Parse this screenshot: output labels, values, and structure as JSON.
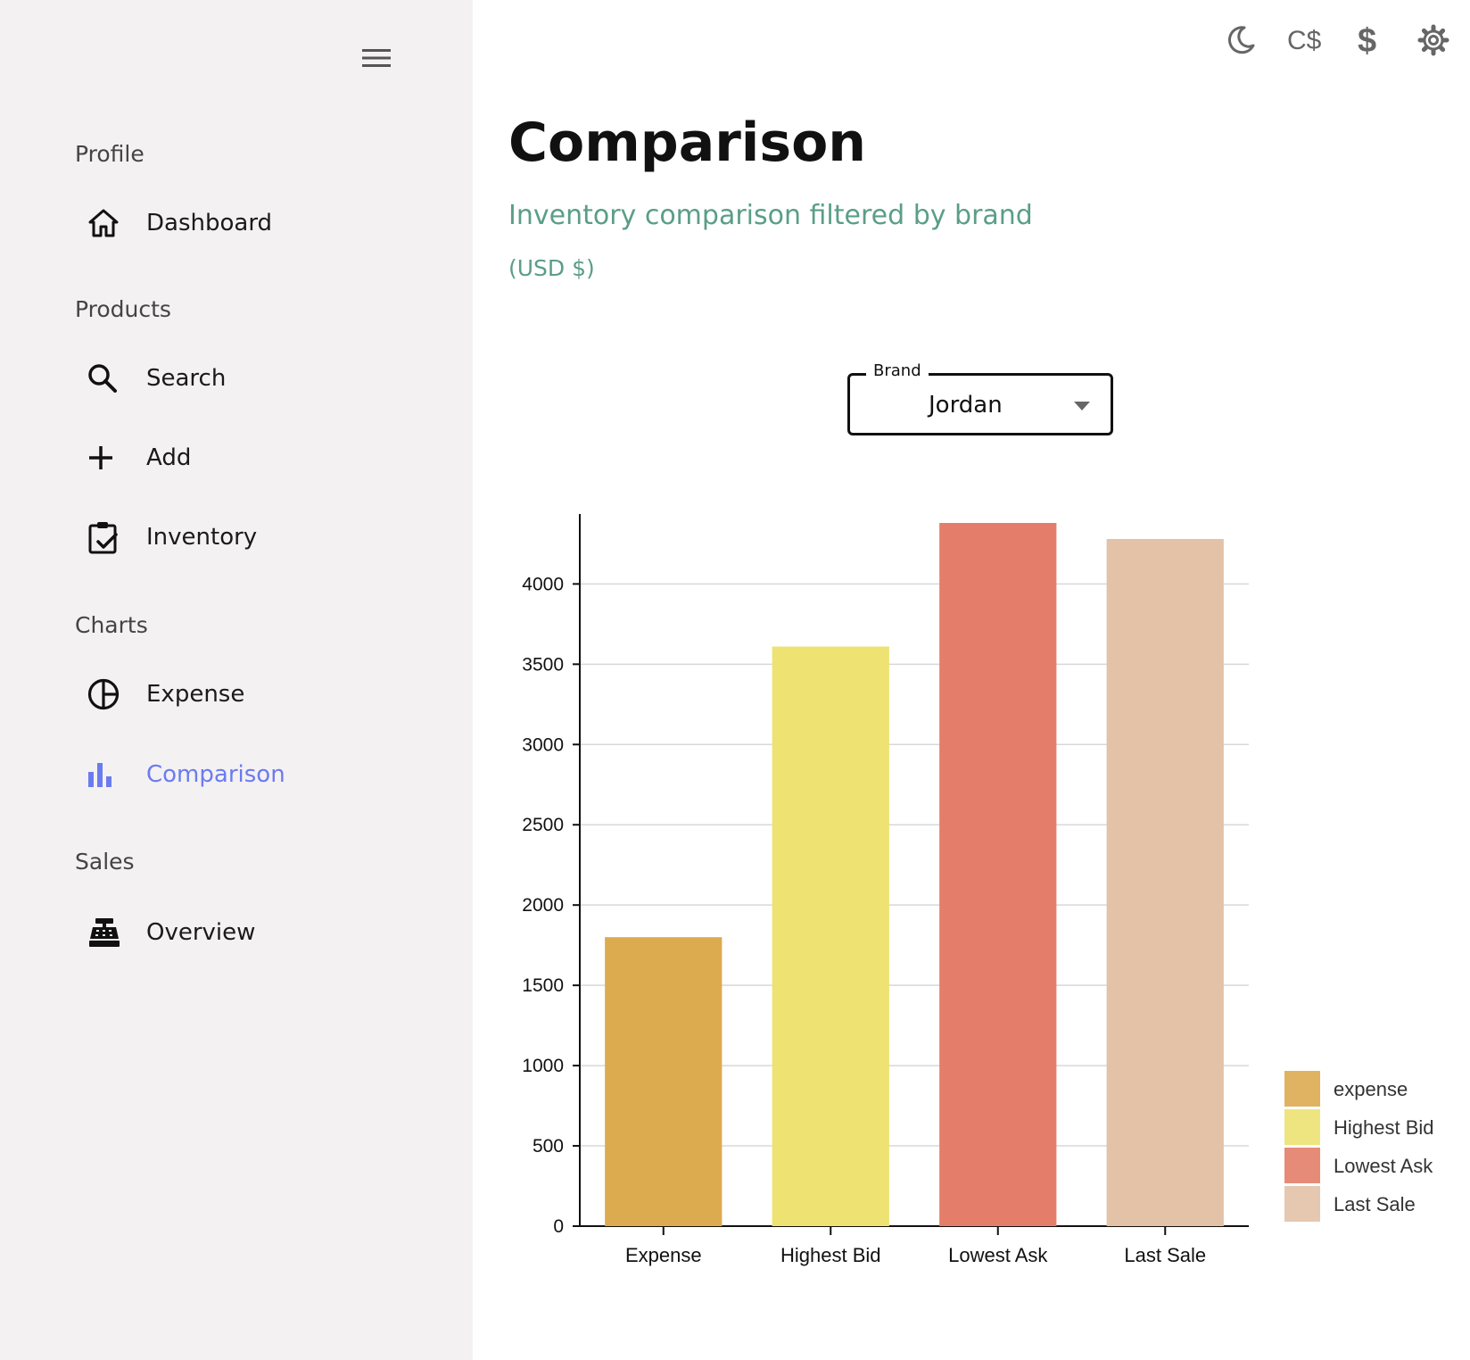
{
  "sidebar": {
    "sections": [
      {
        "label": "Profile",
        "items": [
          {
            "label": "Dashboard",
            "icon": "home-icon"
          }
        ]
      },
      {
        "label": "Products",
        "items": [
          {
            "label": "Search",
            "icon": "search-icon"
          },
          {
            "label": "Add",
            "icon": "plus-icon"
          },
          {
            "label": "Inventory",
            "icon": "clipboard-check-icon"
          }
        ]
      },
      {
        "label": "Charts",
        "items": [
          {
            "label": "Expense",
            "icon": "pie-chart-icon"
          },
          {
            "label": "Comparison",
            "icon": "bar-chart-icon",
            "active": true
          }
        ]
      },
      {
        "label": "Sales",
        "items": [
          {
            "label": "Overview",
            "icon": "cash-register-icon"
          }
        ]
      }
    ],
    "active_color": "#6b7bef"
  },
  "header": {
    "icons": [
      "moon-icon",
      "cad-currency-icon",
      "usd-currency-icon",
      "gear-icon"
    ]
  },
  "main": {
    "title": "Comparison",
    "subtitle": "Inventory comparison filtered by brand",
    "currency": "(USD $)",
    "accent_color": "#5a9e86"
  },
  "filter": {
    "label": "Brand",
    "value": "Jordan"
  },
  "chart_data": {
    "type": "bar",
    "categories": [
      "Expense",
      "Highest Bid",
      "Lowest Ask",
      "Last Sale"
    ],
    "values": [
      1800,
      3610,
      4380,
      4280
    ],
    "colors": [
      "#dcab50",
      "#ede272",
      "#e47e6a",
      "#e3c2a7"
    ],
    "ylim": [
      0,
      4380
    ],
    "yticks": [
      0,
      500,
      1000,
      1500,
      2000,
      2500,
      3000,
      3500,
      4000
    ],
    "legend": [
      "expense",
      "Highest Bid",
      "Lowest Ask",
      "Last Sale"
    ],
    "legend_position": "bottom-right",
    "grid": true
  }
}
